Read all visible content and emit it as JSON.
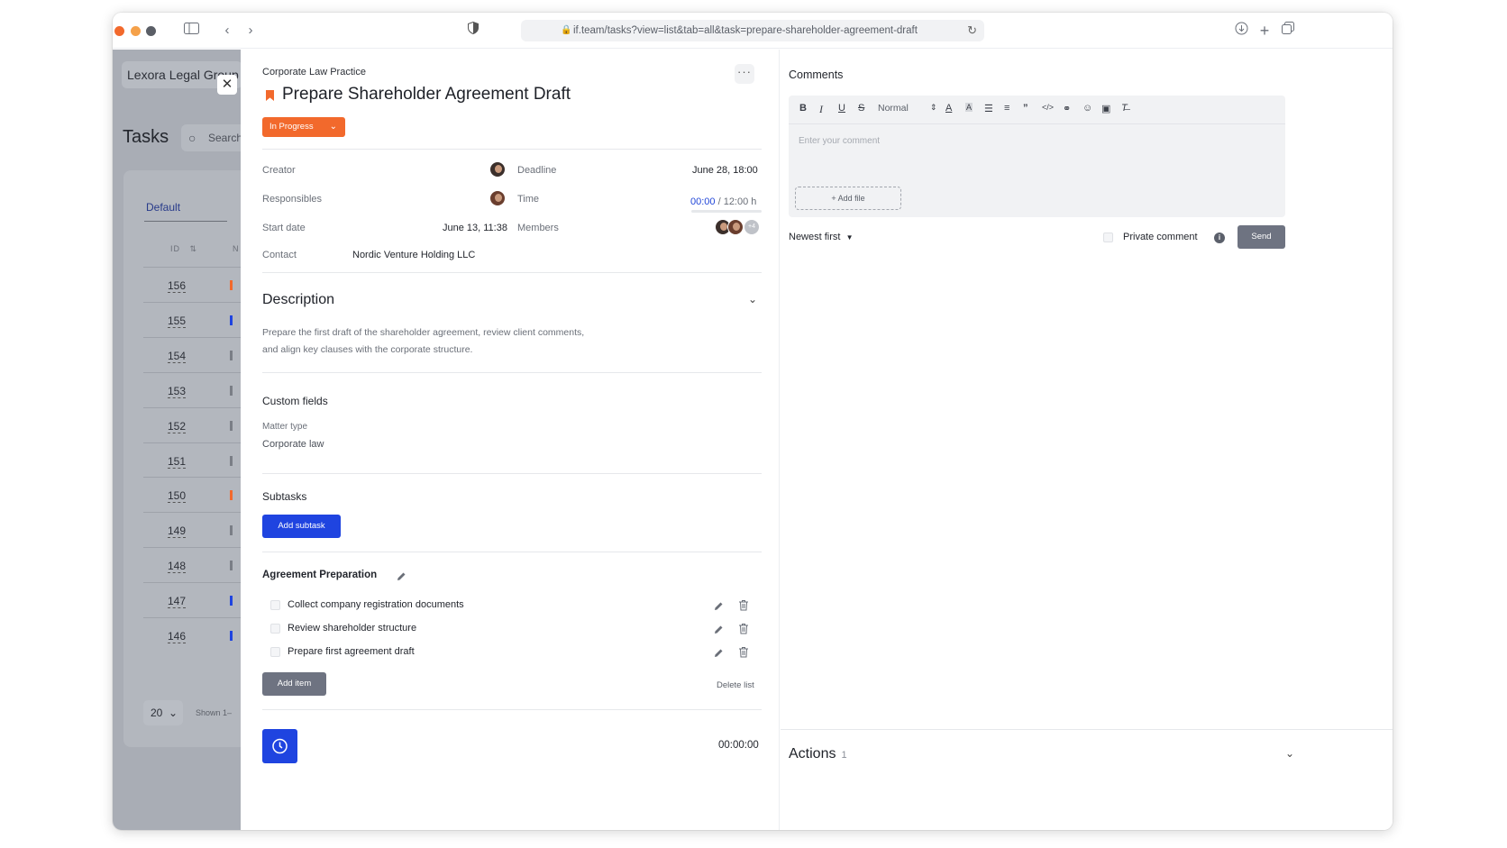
{
  "browser": {
    "url": "if.team/tasks?view=list&tab=all&task=prepare-shareholder-agreement-draft"
  },
  "left": {
    "org": "Lexora Legal Group",
    "title": "Tasks",
    "search_placeholder": "Search",
    "tab": "Default",
    "col_id": "ID",
    "col_n": "N",
    "rows": [
      {
        "id": "156",
        "color": "#f2692c"
      },
      {
        "id": "155",
        "color": "#1f44e0"
      },
      {
        "id": "154",
        "color": "#7a7e86"
      },
      {
        "id": "153",
        "color": "#7a7e86"
      },
      {
        "id": "152",
        "color": "#7a7e86"
      },
      {
        "id": "151",
        "color": "#7a7e86"
      },
      {
        "id": "150",
        "color": "#f2692c"
      },
      {
        "id": "149",
        "color": "#7a7e86"
      },
      {
        "id": "148",
        "color": "#7a7e86"
      },
      {
        "id": "147",
        "color": "#1f44e0"
      },
      {
        "id": "146",
        "color": "#1f44e0"
      }
    ],
    "page_size": "20",
    "shown": "Shown 1–"
  },
  "task": {
    "company": "Corporate Law Practice",
    "title": "Prepare Shareholder Agreement Draft",
    "status": "In Progress",
    "creator_label": "Creator",
    "responsibles_label": "Responsibles",
    "start_label": "Start date",
    "start_value": "June 13, 11:38",
    "contact_label": "Contact",
    "contact_value": "Nordic Venture Holding LLC",
    "deadline_label": "Deadline",
    "deadline_value": "June 28, 18:00",
    "time_label": "Time",
    "time_spent": "00:00",
    "time_total": " / 12:00 h",
    "members_label": "Members",
    "members_more": "+4",
    "description_title": "Description",
    "description_line1": "Prepare the first draft of the shareholder agreement, review client comments,",
    "description_line2": "and align key clauses with the corporate structure.",
    "custom_title": "Custom fields",
    "custom_label": "Matter type",
    "custom_value": "Corporate law",
    "subtasks_title": "Subtasks",
    "add_subtask": "Add subtask",
    "checklist_title": "Agreement Preparation",
    "checklist": [
      "Collect company registration documents",
      "Review shareholder structure",
      "Prepare first agreement draft"
    ],
    "add_item": "Add item",
    "delete_list": "Delete list",
    "timer": "00:00:00"
  },
  "comments": {
    "title": "Comments",
    "format": "Normal",
    "placeholder": "Enter your comment",
    "add_file": "+ Add file",
    "sort": "Newest first",
    "private": "Private comment",
    "send": "Send",
    "actions_title": "Actions",
    "actions_count": "1"
  }
}
